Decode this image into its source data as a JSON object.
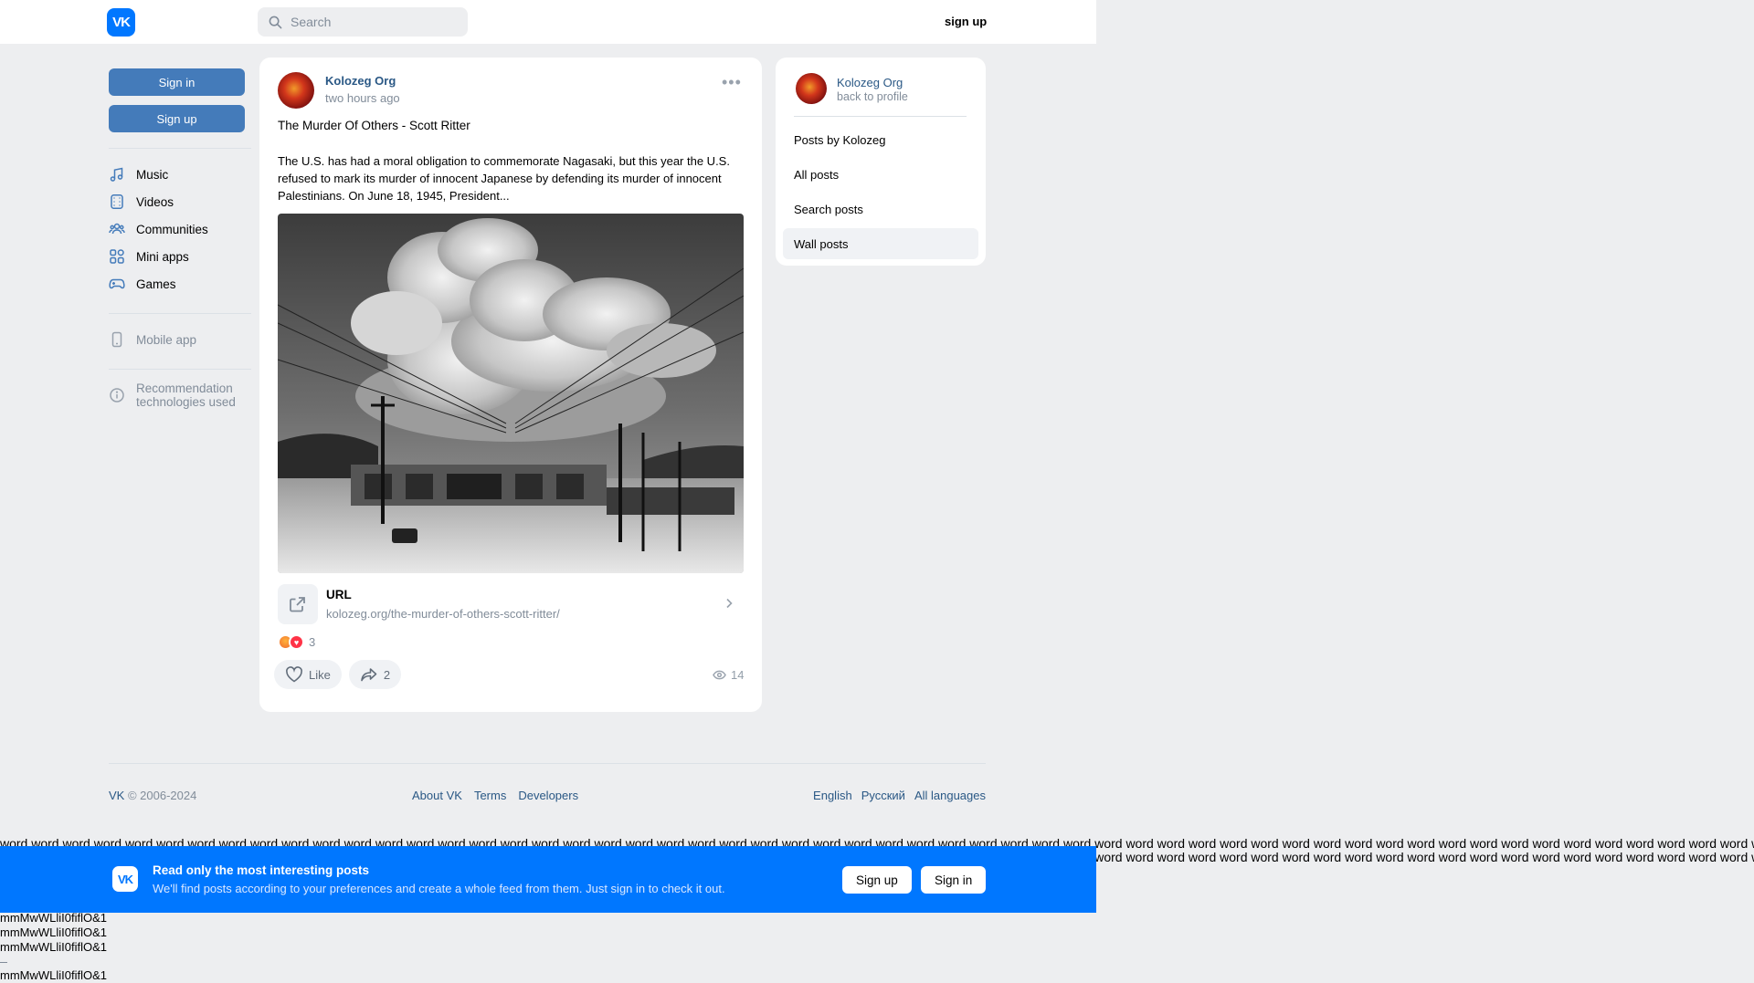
{
  "header": {
    "logo_text": "VK",
    "search_placeholder": "Search",
    "signup_label": "sign up"
  },
  "leftnav": {
    "signin_label": "Sign in",
    "signup_label": "Sign up",
    "items": [
      {
        "label": "Music",
        "icon": "music-icon"
      },
      {
        "label": "Videos",
        "icon": "videos-icon"
      },
      {
        "label": "Communities",
        "icon": "communities-icon"
      },
      {
        "label": "Mini apps",
        "icon": "mini-apps-icon"
      },
      {
        "label": "Games",
        "icon": "games-icon"
      }
    ],
    "mobile_app_label": "Mobile app",
    "rec_tech_label_1": "Recommendation",
    "rec_tech_label_2": "technologies used"
  },
  "post": {
    "author": "Kolozeg Org",
    "time": "two hours ago",
    "more_glyph": "•••",
    "title": "The Murder Of Others - Scott Ritter",
    "text": "The U.S. has had a moral obligation to commemorate Nagasaki, but this year the U.S. refused to mark its murder of innocent Japanese by defending its murder of innocent Palestinians. On June 18, 1945, President...",
    "link_title": "URL",
    "link_url": "kolozeg.org/the-murder-of-others-scott-ritter/",
    "reactions_count": "3",
    "like_label": "Like",
    "share_count": "2",
    "views_count": "14"
  },
  "rightpanel": {
    "name": "Kolozeg Org",
    "back_label": "back to profile",
    "menu": [
      {
        "label": "Posts by Kolozeg",
        "active": false
      },
      {
        "label": "All posts",
        "active": false
      },
      {
        "label": "Search posts",
        "active": false
      },
      {
        "label": "Wall posts",
        "active": true
      }
    ]
  },
  "footer": {
    "vk_link": "VK",
    "copyright": " © 2006-2024",
    "about": "About VK",
    "terms": "Terms",
    "developers": "Developers",
    "lang_english": "English",
    "lang_russian": "Русский",
    "all_languages": "All languages"
  },
  "wordstrip": {
    "line1": "word word word word word word word word word word word word word word word word word word word word word word word word word word word word word word word word word word word word word word word word word word word word word word word word word word word word word word word word word word word",
    "line2": "word word word word word word word word word word word word word word word word word word word word word word word word word word word word word word word word word word word word word word word word word word word word word word word word word word word word word word word word word word word"
  },
  "banner": {
    "logo_text": "VK",
    "title": "Read only the most interesting posts",
    "subtitle": "We'll find posts according to your preferences and create a whole feed from them. Just sign in to check it out.",
    "signup_label": "Sign up",
    "signin_label": "Sign in"
  },
  "test_strings": {
    "line1": "mmMwWLliI0fiflO&1",
    "line2": "mmMwWLliI0fiflO&1",
    "line3": "mmMwWLliI0fiflO&1",
    "line4": "mmMwWLliI0fiflO&1"
  },
  "colors": {
    "accent": "#0077ff",
    "button_blue": "#447bba",
    "link": "#2a5885",
    "muted": "#818c99",
    "page_bg": "#edeef0"
  }
}
